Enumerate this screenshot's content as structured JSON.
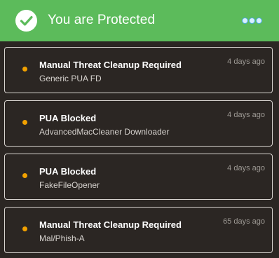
{
  "header": {
    "status_icon": "checkmark-circle-icon",
    "title": "You are Protected",
    "more_icon": "more-dots-icon",
    "background_color": "#5cbb5b"
  },
  "alerts": [
    {
      "title": "Manual Threat Cleanup Required",
      "detail": "Generic PUA FD",
      "time": "4 days ago",
      "bullet_color": "#f2a100"
    },
    {
      "title": "PUA Blocked",
      "detail": "AdvancedMacCleaner Downloader",
      "time": "4 days ago",
      "bullet_color": "#f2a100"
    },
    {
      "title": "PUA Blocked",
      "detail": "FakeFileOpener",
      "time": "4 days ago",
      "bullet_color": "#f2a100"
    },
    {
      "title": "Manual Threat Cleanup Required",
      "detail": "Mal/Phish-A",
      "time": "65 days ago",
      "bullet_color": "#f2a100"
    }
  ]
}
